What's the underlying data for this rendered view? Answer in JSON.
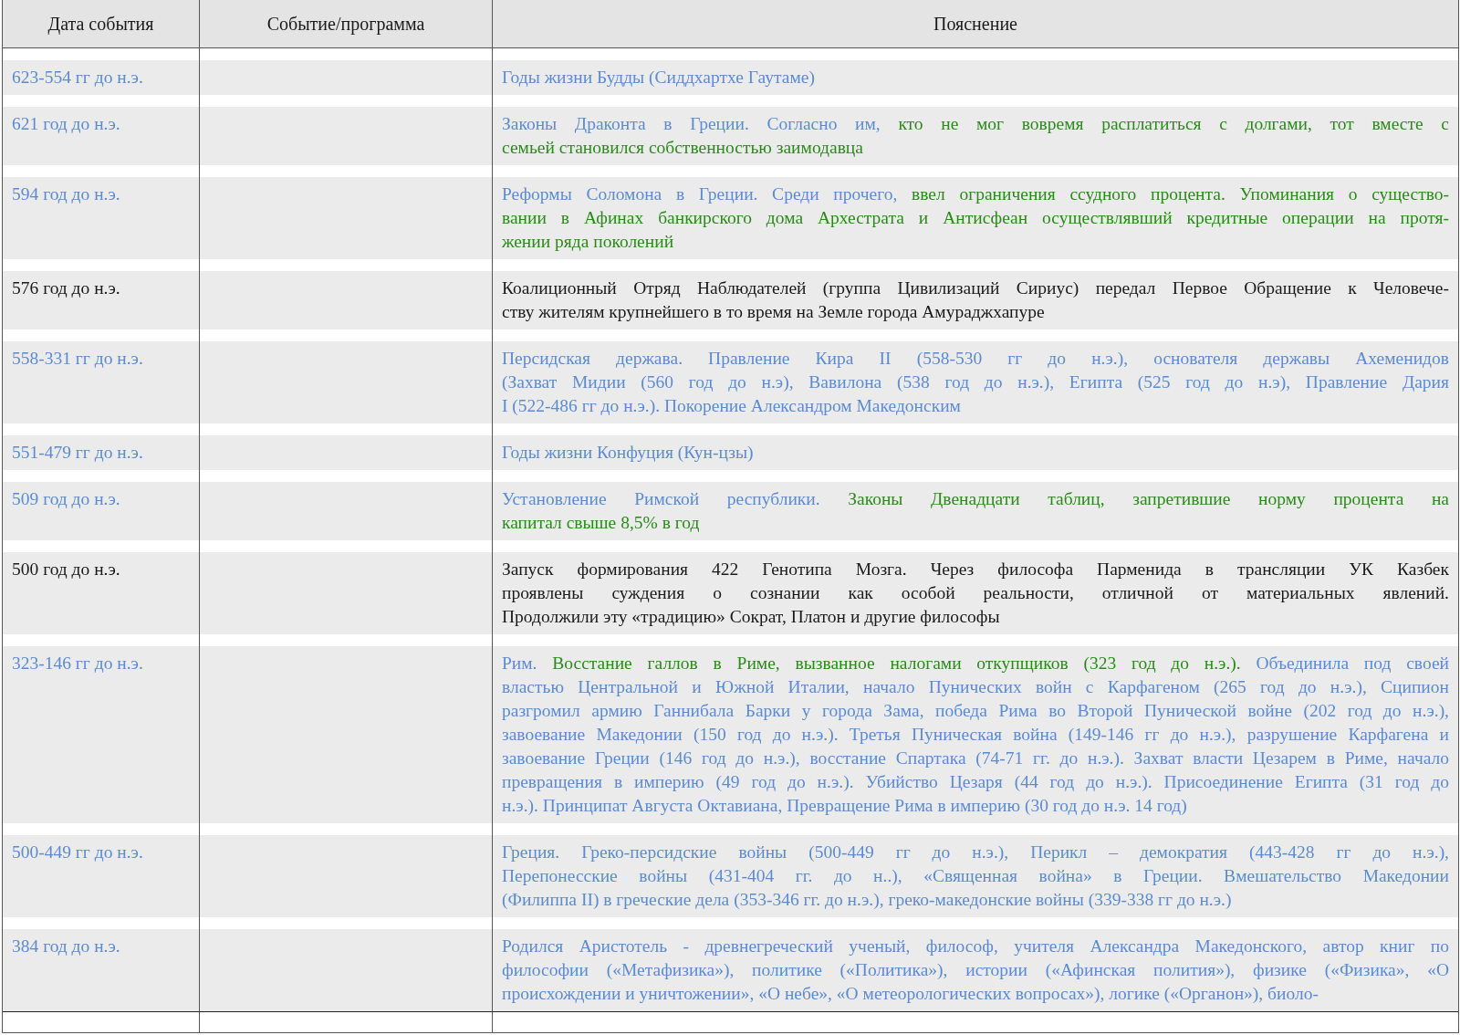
{
  "table": {
    "columns": [
      "Дата события",
      "Событие/программа",
      "Пояснение"
    ],
    "rows": [
      {
        "date": {
          "text": "623-554 гг до н.э.",
          "color": "#5b8bd0"
        },
        "lines": [
          [
            {
              "text": "Годы жизни Будды (Сиддхартхе Гаутаме)",
              "color": "#5b8bd0"
            }
          ]
        ]
      },
      {
        "date": {
          "text": "621 год до н.э.",
          "color": "#5b8bd0"
        },
        "lines": [
          [
            {
              "text": "Законы Драконта в Греции. Согласно им, ",
              "color": "#5b8bd0"
            },
            {
              "text": "кто не мог вовремя расплатиться с долгами, тот вместе с",
              "color": "#2a8a1a"
            }
          ],
          [
            {
              "text": "семьей становился собственностью заимодавца",
              "color": "#2a8a1a"
            }
          ]
        ]
      },
      {
        "date": {
          "text": "594 год до н.э.",
          "color": "#5b8bd0"
        },
        "lines": [
          [
            {
              "text": "Реформы Соломона в Греции. Среди прочего, ",
              "color": "#5b8bd0"
            },
            {
              "text": "ввел ограничения ссудного процента. Упоминания о существо-",
              "color": "#2a8a1a"
            }
          ],
          [
            {
              "text": "вании в Афинах банкирского дома Архестрата и Антисфеан осуществлявший кредитные операции на протя-",
              "color": "#2a8a1a"
            }
          ],
          [
            {
              "text": "жении ряда поколений",
              "color": "#2a8a1a"
            }
          ]
        ]
      },
      {
        "date": {
          "text": "576 год до н.э.",
          "color": "#1a1a1a"
        },
        "lines": [
          [
            {
              "text": "Коалиционный Отряд Наблюдателей (группа Цивилизаций Сириус) передал Первое Обращение к Человече-",
              "color": "#1a1a1a"
            }
          ],
          [
            {
              "text": "ству жителям крупнейшего в то время на Земле города Амураджхапуре",
              "color": "#1a1a1a"
            }
          ]
        ]
      },
      {
        "date": {
          "text": "558-331 гг до н.э.",
          "color": "#5b8bd0"
        },
        "lines": [
          [
            {
              "text": "Персидская держава. Правление Кира II (558-530 гг до н.э.), основателя державы Ахеменидов",
              "color": "#5b8bd0"
            }
          ],
          [
            {
              "text": "(Захват Мидии (560 год до н.э), Вавилона (538 год до н.э.), Египта (525 год до н.э), Правление Дария",
              "color": "#5b8bd0"
            }
          ],
          [
            {
              "text": "I (522-486 гг до н.э.). Покорение Александром Македонским",
              "color": "#5b8bd0"
            }
          ]
        ]
      },
      {
        "date": {
          "text": "551-479 гг до н.э.",
          "color": "#5b8bd0"
        },
        "lines": [
          [
            {
              "text": "Годы жизни Конфуция (Кун-цзы)",
              "color": "#5b8bd0"
            }
          ]
        ]
      },
      {
        "date": {
          "text": "509 год до н.э.",
          "color": "#5b8bd0"
        },
        "lines": [
          [
            {
              "text": "Установление Римской республики. ",
              "color": "#5b8bd0"
            },
            {
              "text": "Законы Двенадцати таблиц, запретившие норму процента на",
              "color": "#2a8a1a"
            }
          ],
          [
            {
              "text": "капитал свыше 8,5% в год",
              "color": "#2a8a1a"
            }
          ]
        ]
      },
      {
        "date": {
          "text": "500 год до н.э.",
          "color": "#1a1a1a"
        },
        "lines": [
          [
            {
              "text": "Запуск формирования 422 Генотипа Мозга. Через философа Парменида в трансляции УК Казбек",
              "color": "#1a1a1a"
            }
          ],
          [
            {
              "text": "проявлены суждения о сознании как особой реальности, отличной от материальных явлений.",
              "color": "#1a1a1a"
            }
          ],
          [
            {
              "text": "Продолжили эту «традицию» Сократ, Платон и другие философы",
              "color": "#1a1a1a"
            }
          ]
        ]
      },
      {
        "date": {
          "text": "323-146 гг до н.э.",
          "color": "#5b8bd0"
        },
        "lines": [
          [
            {
              "text": "Рим. ",
              "color": "#5b8bd0"
            },
            {
              "text": "Восстание галлов в Риме, вызванное налогами откупщиков (323 год до н.э.). ",
              "color": "#2a8a1a"
            },
            {
              "text": "Объединила под своей",
              "color": "#5b8bd0"
            }
          ],
          [
            {
              "text": "властью Центральной и Южной Италии, начало Пунических войн с Карфагеном (265 год до н.э.), Сципион",
              "color": "#5b8bd0"
            }
          ],
          [
            {
              "text": "разгромил армию Ганнибала Барки у города Зама, победа Рима во Второй Пунической войне (202 год  до н.э.),",
              "color": "#5b8bd0"
            }
          ],
          [
            {
              "text": "завоевание Македонии (150 год до н.э.). Третья Пуническая война (149-146 гг до н.э.), разрушение Карфагена и",
              "color": "#5b8bd0"
            }
          ],
          [
            {
              "text": "завоевание Греции (146 год до н.э.), восстание Спартака (74-71 гг. до н.э.). Захват власти Цезарем в Риме, начало",
              "color": "#5b8bd0"
            }
          ],
          [
            {
              "text": "превращения в империю (49 год до н.э.). Убийство Цезаря (44 год до н.э.). Присоединение Египта (31 год до",
              "color": "#5b8bd0"
            }
          ],
          [
            {
              "text": "н.э.). Принципат Августа Октавиана, Превращение Рима в империю (30 год до н.э. 14 год)",
              "color": "#5b8bd0"
            }
          ]
        ]
      },
      {
        "date": {
          "text": "500-449 гг до н.э.",
          "color": "#5b8bd0"
        },
        "lines": [
          [
            {
              "text": "Греция. Греко-персидские войны (500-449 гг до н.э.), Перикл – демократия (443-428 гг до н.э.),",
              "color": "#5b8bd0"
            }
          ],
          [
            {
              "text": "Перепонесские войны (431-404 гг. до н..), «Священная война» в Греции. Вмешательство Македонии",
              "color": "#5b8bd0"
            }
          ],
          [
            {
              "text": "(Филиппа II) в греческие дела (353-346 гг. до н.э.), греко-македонские войны (339-338 гг до н.э.)",
              "color": "#5b8bd0"
            }
          ]
        ]
      },
      {
        "date": {
          "text": "384 год до н.э.",
          "color": "#5b8bd0"
        },
        "lines": [
          [
            {
              "text": "Родился Аристотель - древнегреческий ученый, философ, учителя Александра Македонского, автор книг по",
              "color": "#5b8bd0"
            }
          ],
          [
            {
              "text": "философии («Метафизика»), политике («Политика»), истории («Афинская полития»), физике («Физика», «О",
              "color": "#5b8bd0"
            }
          ],
          [
            {
              "text": "происхождении и уничтожении», «О небе», «О метеорологических вопросах»), логике  («Органон»),   биоло-",
              "color": "#5b8bd0"
            }
          ]
        ]
      }
    ]
  }
}
